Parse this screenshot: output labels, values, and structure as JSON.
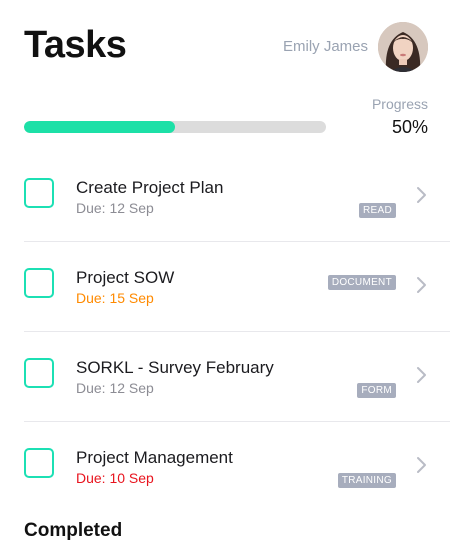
{
  "header": {
    "title": "Tasks",
    "user_name": "Emily James"
  },
  "progress": {
    "label": "Progress",
    "value_text": "50%",
    "fraction": 0.5
  },
  "tasks": [
    {
      "name": "Create Project Plan",
      "due": "Due: 12 Sep",
      "badge": "READ",
      "due_status": "normal",
      "badge_position": "low"
    },
    {
      "name": "Project SOW",
      "due": "Due: 15 Sep",
      "badge": "DOCUMENT",
      "due_status": "orange",
      "badge_position": "high"
    },
    {
      "name": "SORKL - Survey February",
      "due": "Due: 12 Sep",
      "badge": "FORM",
      "due_status": "normal",
      "badge_position": "low"
    },
    {
      "name": "Project Management",
      "due": "Due: 10 Sep",
      "badge": "TRAINING",
      "due_status": "red",
      "badge_position": "low"
    }
  ],
  "completed_heading": "Completed",
  "icons": {
    "row_chevron": "chevron-right-icon",
    "checkbox": "empty-checkbox"
  },
  "colors": {
    "accent": "#1ce0a7",
    "due_orange": "#ff8a00",
    "due_red": "#e8141e",
    "badge_bg": "#a7adbd"
  }
}
